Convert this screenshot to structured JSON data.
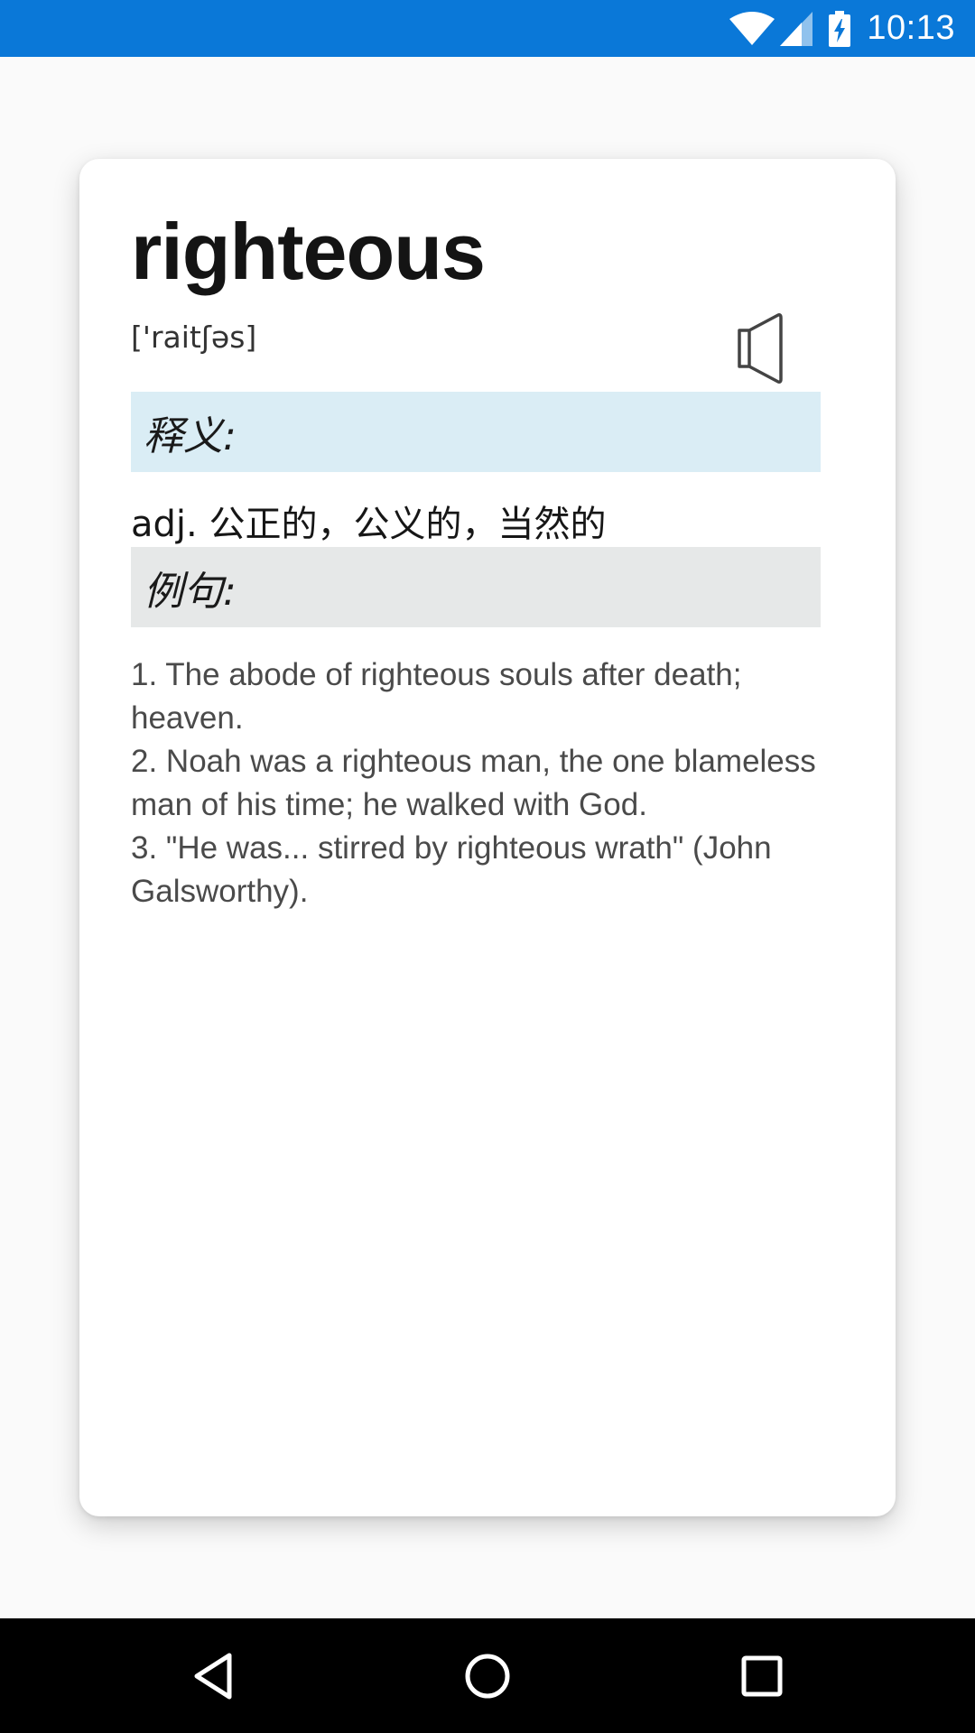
{
  "status_bar": {
    "time": "10:13",
    "icons": [
      "wifi-icon",
      "cell-signal-icon",
      "battery-charging-icon"
    ],
    "color": "#0a78d8"
  },
  "card": {
    "word": "righteous",
    "phonetic": "['raitʃəs]",
    "speaker_icon": "speaker-icon",
    "meaning_heading": "释义:",
    "meaning": "adj. 公正的，公义的，当然的",
    "examples_heading": "例句:",
    "examples": [
      "1. The abode of righteous souls after death; heaven.",
      "2. Noah was a righteous man, the one blameless man of his time; he walked with God.",
      "3. \"He was... stirred by righteous wrath\" (John Galsworthy)."
    ],
    "colors": {
      "meaning_heading_bg": "#daedf5",
      "examples_heading_bg": "#e6e8e8"
    }
  },
  "nav_bar": {
    "buttons": [
      "back-icon",
      "home-icon",
      "recent-apps-icon"
    ]
  }
}
